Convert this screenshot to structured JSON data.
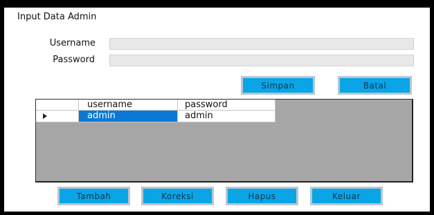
{
  "window": {
    "title": "Input Data Admin"
  },
  "form": {
    "username_label": "Username",
    "password_label": "Password",
    "username_value": "",
    "password_value": ""
  },
  "buttons": {
    "simpan": "Simpan",
    "batal": "Batal",
    "tambah": "Tambah",
    "koreksi": "Koreksi",
    "hapus": "Hapus",
    "keluar": "Keluar"
  },
  "table": {
    "columns": [
      "username",
      "password"
    ],
    "rows": [
      {
        "username": "admin",
        "password": "admin",
        "selected": true
      }
    ]
  },
  "colors": {
    "button": "#0aa5e6",
    "selection": "#0b78d6",
    "grid_background": "#a6a6a6"
  }
}
